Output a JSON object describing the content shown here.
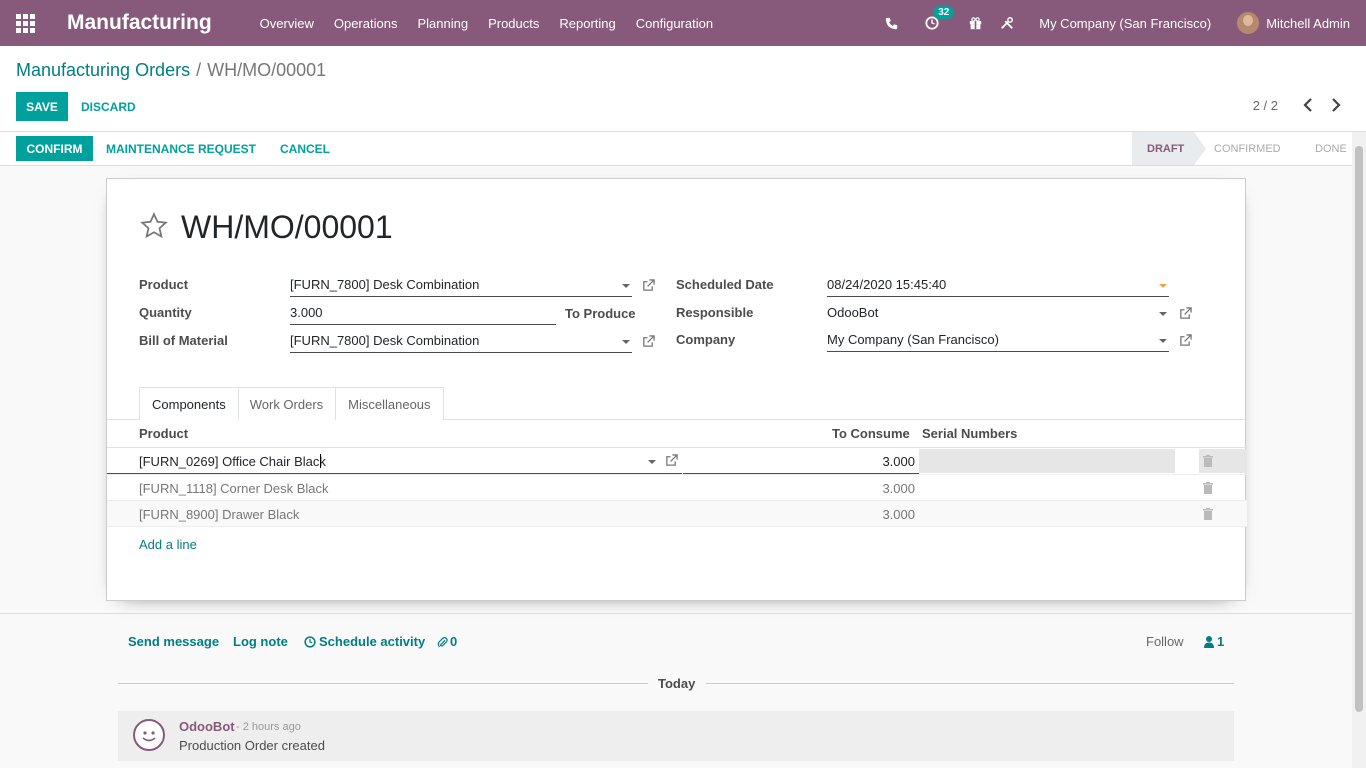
{
  "navbar": {
    "app_name": "Manufacturing",
    "menu": [
      "Overview",
      "Operations",
      "Planning",
      "Products",
      "Reporting",
      "Configuration"
    ],
    "activity_count": "32",
    "company": "My Company (San Francisco)",
    "user": "Mitchell Admin",
    "bg_color": "#875a7b"
  },
  "breadcrumb": {
    "parent": "Manufacturing Orders",
    "separator": "/",
    "current": "WH/MO/00001"
  },
  "actions": {
    "save": "SAVE",
    "discard": "DISCARD"
  },
  "pager": {
    "value": "2 / 2"
  },
  "statusbar": {
    "confirm": "CONFIRM",
    "maintenance": "MAINTENANCE REQUEST",
    "cancel": "CANCEL",
    "stages": [
      "DRAFT",
      "CONFIRMED",
      "DONE"
    ],
    "active_stage": "DRAFT"
  },
  "form": {
    "title": "WH/MO/00001",
    "product_label": "Product",
    "product_value": "[FURN_7800] Desk Combination",
    "quantity_label": "Quantity",
    "quantity_value": "3.000",
    "to_produce": "To Produce",
    "bom_label": "Bill of Material",
    "bom_value": "[FURN_7800] Desk Combination",
    "scheduled_label": "Scheduled Date",
    "scheduled_value": "08/24/2020 15:45:40",
    "responsible_label": "Responsible",
    "responsible_value": "OdooBot",
    "company_label": "Company",
    "company_value": "My Company (San Francisco)"
  },
  "tabs": [
    "Components",
    "Work Orders",
    "Miscellaneous"
  ],
  "components": {
    "headers": {
      "product": "Product",
      "to_consume": "To Consume",
      "serial": "Serial Numbers"
    },
    "rows": [
      {
        "product": "[FURN_0269] Office Chair Black",
        "qty": "3.000"
      },
      {
        "product": "[FURN_1118] Corner Desk Black",
        "qty": "3.000"
      },
      {
        "product": "[FURN_8900] Drawer Black",
        "qty": "3.000"
      }
    ],
    "add_line": "Add a line"
  },
  "chatter": {
    "send_message": "Send message",
    "log_note": "Log note",
    "schedule_activity": "Schedule activity",
    "attachments": "0",
    "follow": "Follow",
    "followers": "1",
    "day": "Today",
    "message": {
      "author": "OdooBot",
      "date": "- 2 hours ago",
      "body": "Production Order created"
    }
  }
}
